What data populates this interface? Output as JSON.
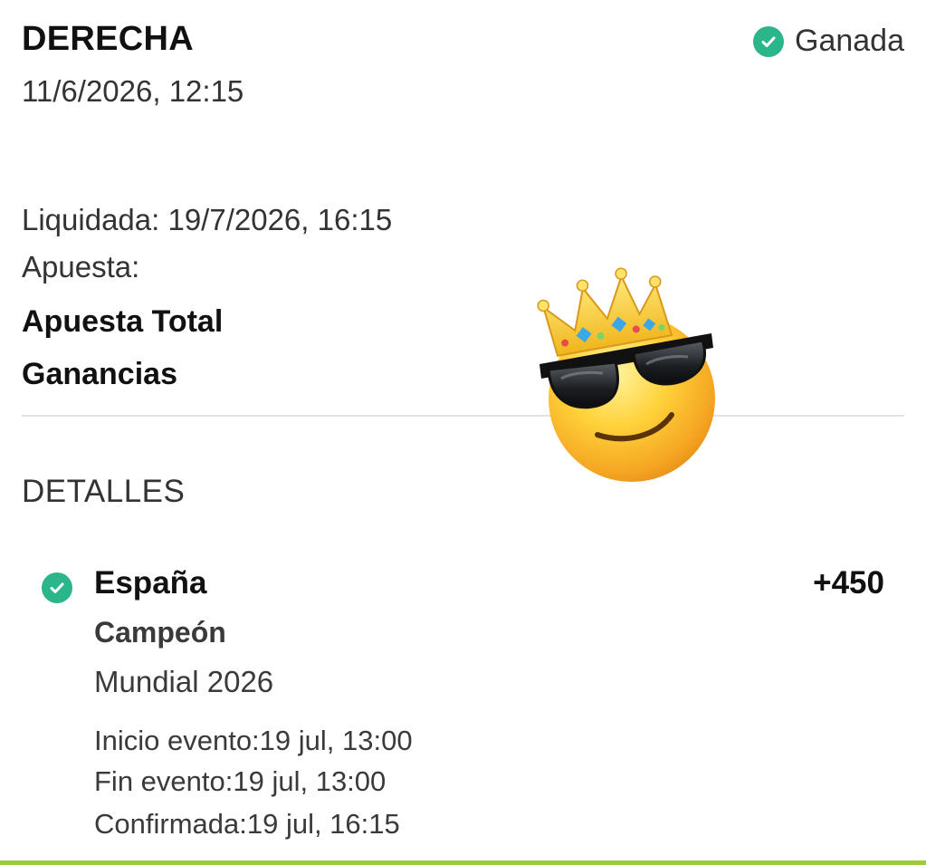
{
  "header": {
    "title": "DERECHA",
    "date": "11/6/2026, 12:15",
    "status": "Ganada"
  },
  "summary": {
    "settled": "Liquidada: 19/7/2026, 16:15",
    "bet_label": "Apuesta:",
    "total_label": "Apuesta Total",
    "winnings_label": "Ganancias"
  },
  "details": {
    "heading": "DETALLES",
    "selection": {
      "team": "España",
      "odds": "+450",
      "market": "Campeón",
      "event": "Mundial 2026",
      "event_start": "Inicio evento:19 jul, 13:00",
      "event_end": "Fin evento:19 jul, 13:00",
      "confirmed": "Confirmada:19 jul, 16:15"
    }
  },
  "colors": {
    "success": "#2bb58a",
    "accent_bar": "#9ccc3c"
  },
  "icons": {
    "status": "check-circle-icon",
    "sticker": "cool-face-crown-emoji"
  }
}
